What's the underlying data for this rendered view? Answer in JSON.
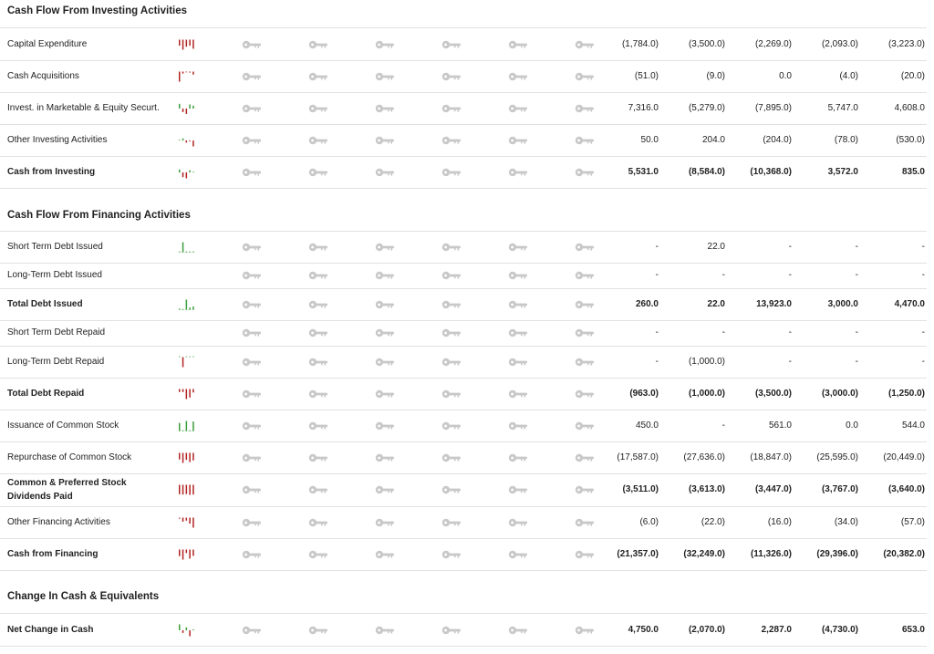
{
  "colors": {
    "negative": "#b22222",
    "positive": "#3a9d3a",
    "lock": "#c8c8c8"
  },
  "lock_icon": "key-lock-icon",
  "sections": [
    {
      "title": "Cash Flow From Investing Activities",
      "rows": [
        {
          "label": "Capital Expenditure",
          "bold": false,
          "spark": [
            -0.6,
            -1,
            -0.7,
            -0.6,
            -0.9
          ],
          "values": [
            "(1,784.0)",
            "(3,500.0)",
            "(2,269.0)",
            "(2,093.0)",
            "(3,223.0)"
          ]
        },
        {
          "label": "Cash Acquisitions",
          "bold": false,
          "spark": [
            -1,
            -0.2,
            -0.05,
            -0.1,
            -0.3
          ],
          "values": [
            "(51.0)",
            "(9.0)",
            "0.0",
            "(4.0)",
            "(20.0)"
          ]
        },
        {
          "label": "Invest. in Marketable & Equity Securt.",
          "bold": false,
          "spark": [
            0.8,
            -0.6,
            -0.9,
            0.7,
            0.5
          ],
          "values": [
            "7,316.0",
            "(5,279.0)",
            "(7,895.0)",
            "5,747.0",
            "4,608.0"
          ]
        },
        {
          "label": "Other Investing Activities",
          "bold": false,
          "spark": [
            0.1,
            0.35,
            -0.35,
            -0.15,
            -1
          ],
          "values": [
            "50.0",
            "204.0",
            "(204.0)",
            "(78.0)",
            "(530.0)"
          ]
        },
        {
          "label": "Cash from Investing",
          "bold": true,
          "spark": [
            0.5,
            -0.8,
            -1,
            0.35,
            0.1
          ],
          "values": [
            "5,531.0",
            "(8,584.0)",
            "(10,368.0)",
            "3,572.0",
            "835.0"
          ]
        }
      ]
    },
    {
      "title": "Cash Flow From Financing Activities",
      "rows": [
        {
          "label": "Short Term Debt Issued",
          "bold": false,
          "spark": [
            0,
            1,
            0,
            0,
            0
          ],
          "values": [
            "-",
            "22.0",
            "-",
            "-",
            "-"
          ]
        },
        {
          "label": "Long-Term Debt Issued",
          "bold": false,
          "spark": [],
          "values": [
            "-",
            "-",
            "-",
            "-",
            "-"
          ]
        },
        {
          "label": "Total Debt Issued",
          "bold": true,
          "spark": [
            0.1,
            0.05,
            1,
            0.22,
            0.32
          ],
          "values": [
            "260.0",
            "22.0",
            "13,923.0",
            "3,000.0",
            "4,470.0"
          ]
        },
        {
          "label": "Short Term Debt Repaid",
          "bold": false,
          "spark": [],
          "values": [
            "-",
            "-",
            "-",
            "-",
            "-"
          ]
        },
        {
          "label": "Long-Term Debt Repaid",
          "bold": false,
          "spark": [
            0,
            -1,
            0,
            0,
            0
          ],
          "values": [
            "-",
            "(1,000.0)",
            "-",
            "-",
            "-"
          ]
        },
        {
          "label": "Total Debt Repaid",
          "bold": true,
          "spark": [
            -0.3,
            -0.3,
            -1,
            -0.85,
            -0.35
          ],
          "values": [
            "(963.0)",
            "(1,000.0)",
            "(3,500.0)",
            "(3,000.0)",
            "(1,250.0)"
          ]
        },
        {
          "label": "Issuance of Common Stock",
          "bold": false,
          "spark": [
            0.8,
            0,
            1,
            0.05,
            0.95
          ],
          "values": [
            "450.0",
            "-",
            "561.0",
            "0.0",
            "544.0"
          ]
        },
        {
          "label": "Repurchase of Common Stock",
          "bold": false,
          "spark": [
            -0.65,
            -1,
            -0.7,
            -0.92,
            -0.75
          ],
          "values": [
            "(17,587.0)",
            "(27,636.0)",
            "(18,847.0)",
            "(25,595.0)",
            "(20,449.0)"
          ]
        },
        {
          "label": "Common & Preferred Stock Dividends Paid",
          "label_lines": [
            "Common & Preferred Stock",
            "Dividends Paid"
          ],
          "bold": true,
          "spark": [
            -0.95,
            -0.97,
            -0.93,
            -1,
            -0.97
          ],
          "values": [
            "(3,511.0)",
            "(3,613.0)",
            "(3,447.0)",
            "(3,767.0)",
            "(3,640.0)"
          ]
        },
        {
          "label": "Other Financing Activities",
          "bold": false,
          "spark": [
            -0.1,
            -0.4,
            -0.3,
            -0.6,
            -1
          ],
          "values": [
            "(6.0)",
            "(22.0)",
            "(16.0)",
            "(34.0)",
            "(57.0)"
          ]
        },
        {
          "label": "Cash from Financing",
          "bold": true,
          "spark": [
            -0.65,
            -1,
            -0.35,
            -0.9,
            -0.63
          ],
          "values": [
            "(21,357.0)",
            "(32,249.0)",
            "(11,326.0)",
            "(29,396.0)",
            "(20,382.0)"
          ]
        }
      ]
    },
    {
      "title": "Change In Cash & Equivalents",
      "rows": [
        {
          "label": "Net Change in Cash",
          "bold": true,
          "spark": [
            1,
            -0.45,
            0.5,
            -1,
            0.15
          ],
          "values": [
            "4,750.0",
            "(2,070.0)",
            "2,287.0",
            "(4,730.0)",
            "653.0"
          ]
        }
      ]
    }
  ]
}
